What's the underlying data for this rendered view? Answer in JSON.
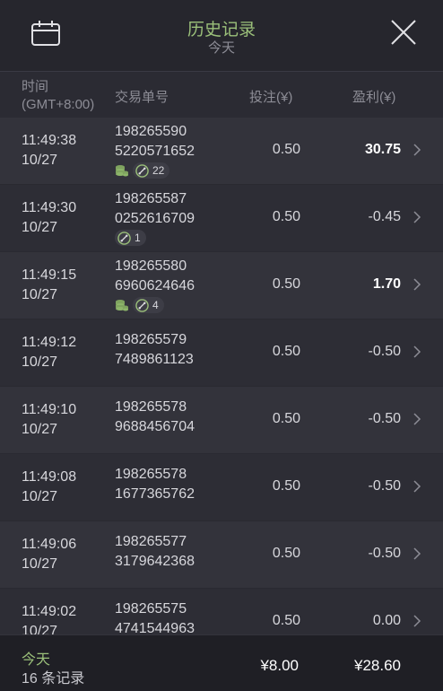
{
  "header": {
    "title": "历史记录",
    "subtitle": "今天",
    "calendar_icon": "calendar-icon",
    "close_icon": "close-icon"
  },
  "columns": {
    "time": "时间",
    "timezone": "(GMT+8:00)",
    "txid": "交易单号",
    "stake": "投注(¥)",
    "profit": "盈利(¥)"
  },
  "rows": [
    {
      "time": "11:49:38",
      "date": "10/27",
      "id_line1": "198265590",
      "id_line2": "5220571652",
      "stake": "0.50",
      "profit": "30.75",
      "win": true,
      "coin": true,
      "link_count": "22"
    },
    {
      "time": "11:49:30",
      "date": "10/27",
      "id_line1": "198265587",
      "id_line2": "0252616709",
      "stake": "0.50",
      "profit": "-0.45",
      "win": false,
      "coin": false,
      "link_count": "1"
    },
    {
      "time": "11:49:15",
      "date": "10/27",
      "id_line1": "198265580",
      "id_line2": "6960624646",
      "stake": "0.50",
      "profit": "1.70",
      "win": true,
      "coin": true,
      "link_count": "4"
    },
    {
      "time": "11:49:12",
      "date": "10/27",
      "id_line1": "198265579",
      "id_line2": "7489861123",
      "stake": "0.50",
      "profit": "-0.50",
      "win": false,
      "coin": false,
      "link_count": ""
    },
    {
      "time": "11:49:10",
      "date": "10/27",
      "id_line1": "198265578",
      "id_line2": "9688456704",
      "stake": "0.50",
      "profit": "-0.50",
      "win": false,
      "coin": false,
      "link_count": ""
    },
    {
      "time": "11:49:08",
      "date": "10/27",
      "id_line1": "198265578",
      "id_line2": "1677365762",
      "stake": "0.50",
      "profit": "-0.50",
      "win": false,
      "coin": false,
      "link_count": ""
    },
    {
      "time": "11:49:06",
      "date": "10/27",
      "id_line1": "198265577",
      "id_line2": "3179642368",
      "stake": "0.50",
      "profit": "-0.50",
      "win": false,
      "coin": false,
      "link_count": ""
    },
    {
      "time": "11:49:02",
      "date": "10/27",
      "id_line1": "198265575",
      "id_line2": "4741544963",
      "stake": "0.50",
      "profit": "0.00",
      "win": false,
      "coin": false,
      "link_count": ""
    }
  ],
  "footer": {
    "label": "今天",
    "count": "16 条记录",
    "total_stake": "¥8.00",
    "total_profit": "¥28.60"
  },
  "colors": {
    "accent_green": "#9bc07a",
    "row_odd": "#33333b",
    "row_even": "#2d2d35",
    "footer_bg": "#1f1f25"
  }
}
